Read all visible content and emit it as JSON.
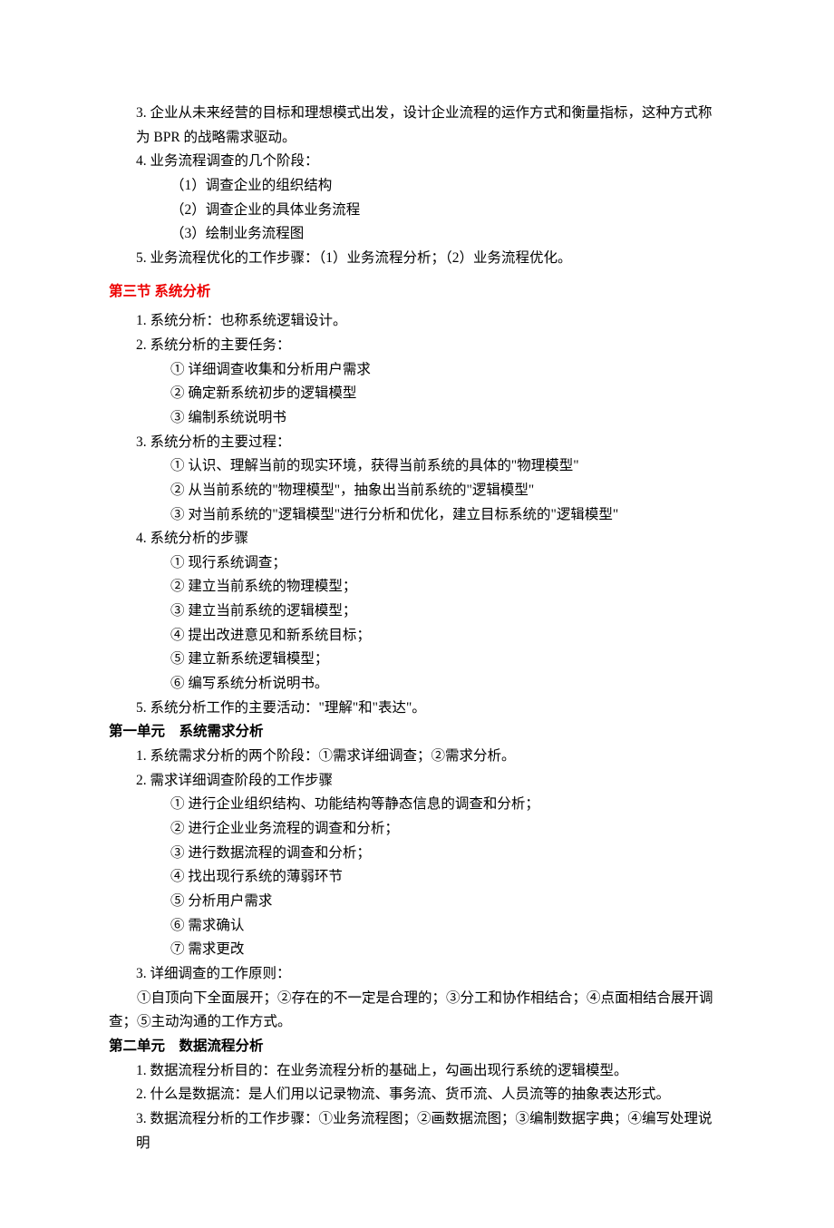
{
  "content": {
    "top_items": [
      {
        "num": "3.",
        "text": "企业从未来经营的目标和理想模式出发，设计企业流程的运作方式和衡量指标，这种方式称为 BPR 的战略需求驱动。"
      },
      {
        "num": "4.",
        "text": "业务流程调查的几个阶段：",
        "subs": [
          "（1）调查企业的组织结构",
          "（2）调查企业的具体业务流程",
          "（3）绘制业务流程图"
        ]
      },
      {
        "num": "5.",
        "text": "业务流程优化的工作步骤：（1）业务流程分析；（2）业务流程优化。"
      }
    ],
    "section3": {
      "title": "第三节  系统分析",
      "items": [
        {
          "num": "1.",
          "text": "系统分析：也称系统逻辑设计。"
        },
        {
          "num": "2.",
          "text": "系统分析的主要任务：",
          "subs": [
            "①  详细调查收集和分析用户需求",
            "②  确定新系统初步的逻辑模型",
            "③  编制系统说明书"
          ]
        },
        {
          "num": "3.",
          "text": "系统分析的主要过程：",
          "subs": [
            "①  认识、理解当前的现实环境，获得当前系统的具体的\"物理模型\"",
            "②  从当前系统的\"物理模型\"，抽象出当前系统的\"逻辑模型\"",
            "③  对当前系统的\"逻辑模型\"进行分析和优化，建立目标系统的\"逻辑模型\""
          ]
        },
        {
          "num": "4.",
          "text": "系统分析的步骤",
          "subs": [
            "①  现行系统调查；",
            "②  建立当前系统的物理模型；",
            "③  建立当前系统的逻辑模型；",
            "④  提出改进意见和新系统目标；",
            "⑤  建立新系统逻辑模型；",
            "⑥  编写系统分析说明书。"
          ]
        },
        {
          "num": "5.",
          "text": "系统分析工作的主要活动：\"理解\"和\"表达\"。"
        }
      ],
      "unit1": {
        "title": "第一单元　系统需求分析",
        "items": [
          {
            "num": "1.",
            "text": "系统需求分析的两个阶段：①需求详细调查；②需求分析。"
          },
          {
            "num": "2.",
            "text": "需求详细调查阶段的工作步骤",
            "subs": [
              "①  进行企业组织结构、功能结构等静态信息的调查和分析；",
              "②  进行企业业务流程的调查和分析；",
              "③  进行数据流程的调查和分析；",
              "④  找出现行系统的薄弱环节",
              "⑤  分析用户需求",
              "⑥  需求确认",
              "⑦  需求更改"
            ]
          },
          {
            "num": "3.",
            "text": "详细调查的工作原则："
          }
        ],
        "followup": "　　①自顶向下全面展开；②存在的不一定是合理的；③分工和协作相结合；④点面相结合展开调查；⑤主动沟通的工作方式。"
      },
      "unit2": {
        "title": "第二单元　数据流程分析",
        "items": [
          {
            "num": "1.",
            "text": "数据流程分析目的：在业务流程分析的基础上，勾画出现行系统的逻辑模型。"
          },
          {
            "num": "2.",
            "text": "什么是数据流：是人们用以记录物流、事务流、货币流、人员流等的抽象表达形式。"
          },
          {
            "num": "3.",
            "text": "数据流程分析的工作步骤：①业务流程图；②画数据流图；③编制数据字典；④编写处理说明"
          }
        ]
      }
    }
  }
}
